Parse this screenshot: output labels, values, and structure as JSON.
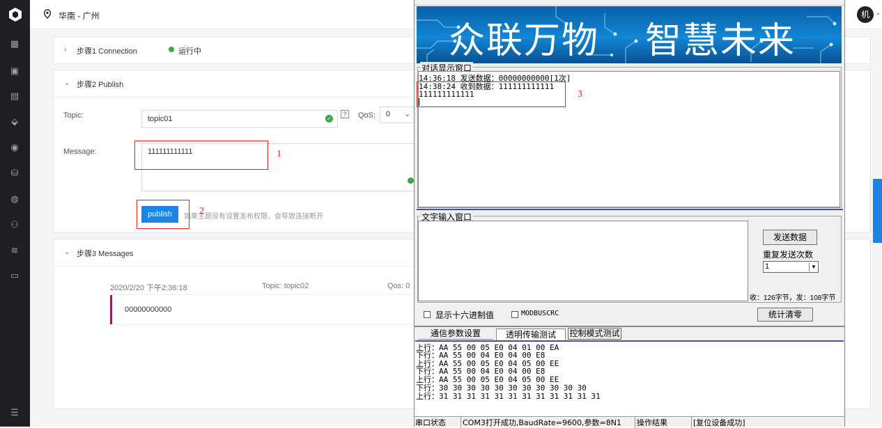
{
  "header": {
    "region": "华南 - 广州",
    "avatar": "机"
  },
  "step1": {
    "title": "步骤1  Connection",
    "status": "运行中"
  },
  "step2": {
    "title": "步骤2  Publish",
    "topic_label": "Topic:",
    "topic_value": "topic01",
    "help": "?",
    "qos_label": "QoS:",
    "qos_value": "0",
    "message_label": "Message:",
    "message_value": "111111111111",
    "publish_label": "publish",
    "warning": "如果主题没有设置发布权限，会导致连接断开",
    "annot1": "1",
    "annot2": "2"
  },
  "step3": {
    "title": "步骤3  Messages",
    "time": "2020/2/20 下午2:36:18",
    "topic": "Topic: topic02",
    "qos": "Qos: 0",
    "payload": "00000000000"
  },
  "serial": {
    "banner": [
      "众联万物",
      "智慧未来"
    ],
    "dialog_title": "对话显示窗口",
    "dialog_lines": [
      "14:36:18 发送数据：00000000000[1次]",
      "14:38:24 收到数据：111111111111",
      "111111111111"
    ],
    "annot3": "3",
    "input_title": "文字输入窗口",
    "send_button": "发送数据",
    "repeat_label": "重复发送次数",
    "repeat_value": "1",
    "counter": "收：126字节，发：108字节",
    "hex_label": "显示十六进制值",
    "modbus_label": "MODBUSCRC",
    "clear_button": "统计清零",
    "tabs": [
      "通信参数设置",
      "透明传输测试",
      "控制模式测试"
    ],
    "log_lines": [
      "上行：AA 55 00 05 E0 04 01 00 EA",
      "下行：AA 55 00 04 E0 04 00 E8",
      "上行：AA 55 00 05 E0 04 05 00 EE",
      "下行：AA 55 00 04 E0 04 00 E8",
      "上行：AA 55 00 05 E0 04 05 00 EE",
      "下行：30 30 30 30 30 30 30 30 30 30 30",
      "上行：31 31 31 31 31 31 31 31 31 31 31 31"
    ],
    "status_port_label": "串口状态",
    "status_port": "COM3打开成功,BaudRate=9600,参数=8N1",
    "status_result_label": "操作结果",
    "status_result": "[复位设备成功]"
  }
}
